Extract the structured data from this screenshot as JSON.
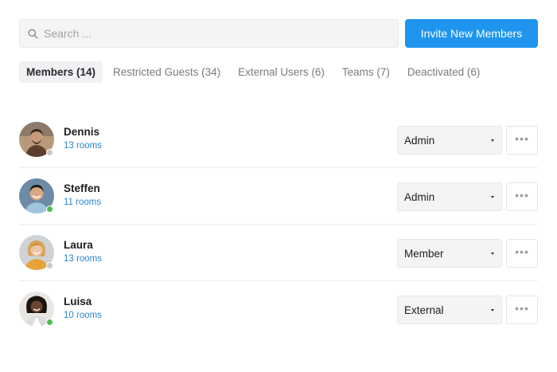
{
  "search": {
    "placeholder": "Search ...",
    "value": ""
  },
  "invite": {
    "label": "Invite New Members"
  },
  "tabs": [
    {
      "label": "Members (14)",
      "active": true
    },
    {
      "label": "Restricted Guests (34)",
      "active": false
    },
    {
      "label": "External Users (6)",
      "active": false
    },
    {
      "label": "Teams (7)",
      "active": false
    },
    {
      "label": "Deactivated (6)",
      "active": false
    }
  ],
  "members": [
    {
      "name": "Dennis",
      "rooms": "13 rooms",
      "role": "Admin",
      "status": "offline"
    },
    {
      "name": "Steffen",
      "rooms": "11 rooms",
      "role": "Admin",
      "status": "online"
    },
    {
      "name": "Laura",
      "rooms": "13 rooms",
      "role": "Member",
      "status": "offline"
    },
    {
      "name": "Luisa",
      "rooms": "10 rooms",
      "role": "External",
      "status": "online"
    }
  ],
  "colors": {
    "accent": "#1f95ee",
    "link": "#2a86c8",
    "online": "#4cbb4c",
    "offline": "#c8c8cc"
  },
  "icons": {
    "search": "search-icon",
    "more": "more-horizontal-icon",
    "dropdown": "caret-down-icon"
  }
}
